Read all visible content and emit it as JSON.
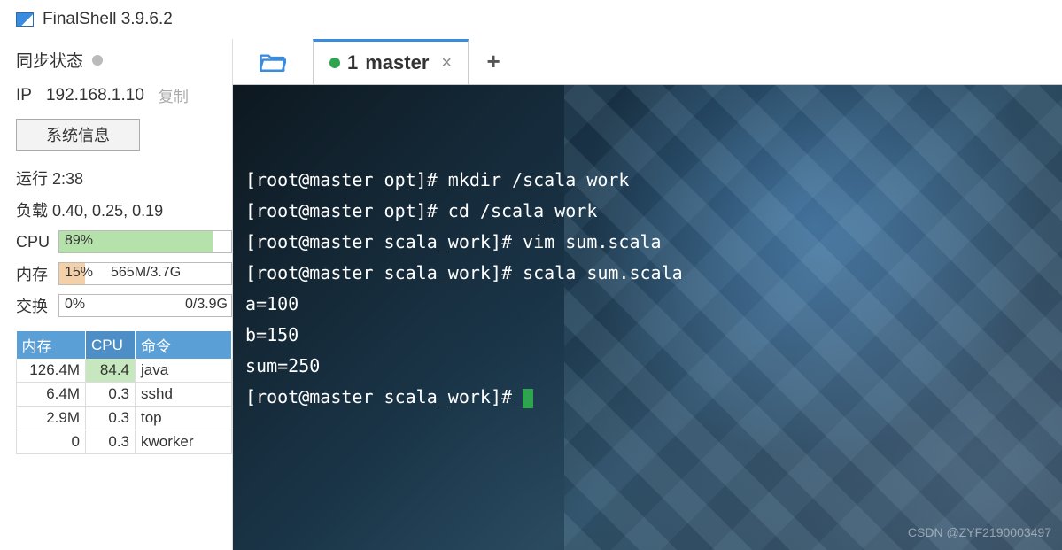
{
  "app": {
    "title": "FinalShell 3.9.6.2"
  },
  "sidebar": {
    "sync_label": "同步状态",
    "ip_label": "IP",
    "ip_value": "192.168.1.10",
    "copy_label": "复制",
    "sysinfo_button": "系统信息",
    "uptime_label": "运行",
    "uptime_value": "2:38",
    "load_label": "负载",
    "load_value": "0.40, 0.25, 0.19",
    "cpu": {
      "label": "CPU",
      "percent": 89,
      "text": "89%"
    },
    "mem": {
      "label": "内存",
      "percent": 15,
      "text": "15%",
      "detail": "565M/3.7G"
    },
    "swap": {
      "label": "交换",
      "percent": 0,
      "text": "0%",
      "detail": "0/3.9G"
    },
    "proc_headers": {
      "mem": "内存",
      "cpu": "CPU",
      "cmd": "命令"
    },
    "processes": [
      {
        "mem": "126.4M",
        "cpu": "84.4",
        "cmd": "java",
        "high": true
      },
      {
        "mem": "6.4M",
        "cpu": "0.3",
        "cmd": "sshd"
      },
      {
        "mem": "2.9M",
        "cpu": "0.3",
        "cmd": "top"
      },
      {
        "mem": "0",
        "cpu": "0.3",
        "cmd": "kworker"
      }
    ]
  },
  "tabs": {
    "active": {
      "index": "1",
      "name": "master"
    },
    "add_label": "+"
  },
  "terminal": {
    "lines": [
      "[root@master opt]# mkdir /scala_work",
      "[root@master opt]# cd /scala_work",
      "[root@master scala_work]# vim sum.scala",
      "[root@master scala_work]# scala sum.scala",
      "a=100",
      "b=150",
      "sum=250",
      "[root@master scala_work]# "
    ]
  },
  "watermark": "CSDN @ZYF2190003497"
}
